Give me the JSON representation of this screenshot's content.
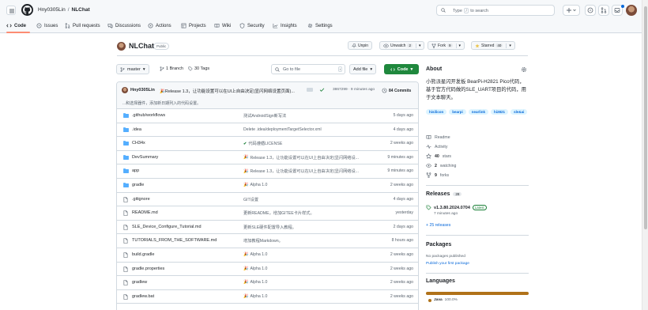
{
  "header": {
    "owner": "Hny0305Lin",
    "separator": "/",
    "repo": "NLChat",
    "search_before": "Type",
    "search_key": "/",
    "search_after": "to search"
  },
  "nav_tabs": [
    {
      "label": "Code",
      "icon": "code-icon"
    },
    {
      "label": "Issues",
      "icon": "issue-icon"
    },
    {
      "label": "Pull requests",
      "icon": "pull-request-icon"
    },
    {
      "label": "Discussions",
      "icon": "discussion-icon"
    },
    {
      "label": "Actions",
      "icon": "play-icon"
    },
    {
      "label": "Projects",
      "icon": "table-icon"
    },
    {
      "label": "Wiki",
      "icon": "book-icon"
    },
    {
      "label": "Security",
      "icon": "shield-icon"
    },
    {
      "label": "Insights",
      "icon": "graph-icon"
    },
    {
      "label": "Settings",
      "icon": "gear-icon"
    }
  ],
  "repo": {
    "name": "NLChat",
    "visibility": "Public",
    "unpin": "Unpin",
    "unwatch": "Unwatch",
    "watch_count": "2",
    "fork": "Fork",
    "fork_count": "9",
    "starred": "Starred",
    "star_count": "40"
  },
  "controls": {
    "branch": "master",
    "branches": "1 Branch",
    "tags": "30 Tags",
    "goto_placeholder": "Go to file",
    "goto_key": "t",
    "add_file": "Add file",
    "code": "Code"
  },
  "commit": {
    "author": "Hny0305Lin",
    "message": "Release 1.3，让功能设置可以在UI上自由决定(显闪网络设置页面)...",
    "hash_time": "3867299 · 9 minutes ago",
    "commits": "84 Commits",
    "description": "...和选择器件，添加新日期列入的代码设置。"
  },
  "files": [
    {
      "type": "folder",
      "name": ".github/workflows",
      "message": "测试AndroidSign新写法",
      "date": "5 days ago",
      "icon": ""
    },
    {
      "type": "folder",
      "name": ".idea",
      "message": "Delete .idea/deploymentTargetSelector.xml",
      "date": "4 days ago",
      "icon": ""
    },
    {
      "type": "folder",
      "name": "CH34x",
      "message": "代码遵循LICENSE",
      "date": "2 weeks ago",
      "icon": "check-icon"
    },
    {
      "type": "folder",
      "name": "DevSummary",
      "message": "Release 1.3，让功能设置可以在UI上自由决定(显闪网络设...",
      "date": "9 minutes ago",
      "icon": "party-icon"
    },
    {
      "type": "folder",
      "name": "app",
      "message": "Release 1.3，让功能设置可以在UI上自由决定(显闪网络设...",
      "date": "9 minutes ago",
      "icon": "party-icon"
    },
    {
      "type": "folder",
      "name": "gradle",
      "message": "Alpha 1.0",
      "date": "2 weeks ago",
      "icon": "party-icon"
    },
    {
      "type": "file",
      "name": ".gitignore",
      "message": "GIT设置",
      "date": "4 days ago",
      "icon": ""
    },
    {
      "type": "file",
      "name": "README.md",
      "message": "更新README，增加GITEE卡片样式。",
      "date": "yesterday",
      "icon": ""
    },
    {
      "type": "file",
      "name": "SLE_Device_Configure_Tutorial.md",
      "message": "更新SLE硬件配置导入教程。",
      "date": "2 days ago",
      "icon": ""
    },
    {
      "type": "file",
      "name": "TUTORIALS_FROM_THE_SOFTWARE.md",
      "message": "增加教程Markdown。",
      "date": "8 hours ago",
      "icon": ""
    },
    {
      "type": "file",
      "name": "build.gradle",
      "message": "Alpha 1.0",
      "date": "2 weeks ago",
      "icon": "party-icon"
    },
    {
      "type": "file",
      "name": "gradle.properties",
      "message": "Alpha 1.0",
      "date": "2 weeks ago",
      "icon": "party-icon"
    },
    {
      "type": "file",
      "name": "gradlew",
      "message": "Alpha 1.0",
      "date": "2 weeks ago",
      "icon": "party-icon"
    },
    {
      "type": "file",
      "name": "gradlew.bat",
      "message": "Alpha 1.0",
      "date": "2 weeks ago",
      "icon": "party-icon"
    }
  ],
  "about": {
    "title": "About",
    "description": "小熊派星闪开发板 BearPi-H2821 Pico代码，基于官方代码做的SLE_UART项目的代码，用于文本聊天。",
    "topics": [
      "hisilicon",
      "bearpi",
      "nearlink",
      "hi2821",
      "sle&ai"
    ],
    "readme": "Readme",
    "activity": "Activity",
    "stars_num": "40",
    "stars_label": "stars",
    "watching_num": "2",
    "watching_label": "watching",
    "forks_num": "9",
    "forks_label": "forks"
  },
  "releases": {
    "title": "Releases",
    "count": "28",
    "tag": "v1.3.80.2024.0704",
    "latest": "Latest",
    "date": "7 minutes ago",
    "more": "+ 25 releases"
  },
  "packages": {
    "title": "Packages",
    "none": "No packages published",
    "publish": "Publish your first package"
  },
  "languages": {
    "title": "Languages",
    "name": "Java",
    "percent": "100.0%",
    "color": "#b07219"
  },
  "colors": {
    "accent": "#0969da",
    "code_button": "#1f883d",
    "tab_underline": "#fd8c73",
    "folder": "#54aeff"
  }
}
